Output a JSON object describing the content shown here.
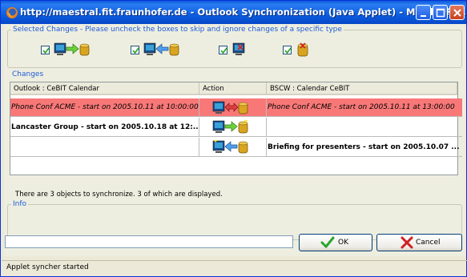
{
  "window": {
    "title": "http://maestral.fit.fraunhofer.de - Outlook Synchronization (Java Applet) - Mozilla Fi..."
  },
  "selected_changes": {
    "legend": "Selected Changes - Please uncheck the boxes to skip and ignore changes of a specific type",
    "options": [
      {
        "checked": true,
        "icon": "new-to-bscw-icon"
      },
      {
        "checked": true,
        "icon": "update-from-bscw-icon"
      },
      {
        "checked": true,
        "icon": "delete-local-icon"
      },
      {
        "checked": true,
        "icon": "delete-remote-icon"
      }
    ]
  },
  "changes": {
    "legend": "Changes",
    "columns": [
      "Outlook : CeBIT Calendar",
      "Action",
      "BSCW : Calendar CeBIT"
    ],
    "rows": [
      {
        "left": "Phone Conf ACME - start on 2005.10.11 at 10:00:00",
        "action": "conflict-icon",
        "right": "Phone Conf ACME - start on 2005.10.11 at 13:00:00",
        "highlight": "#f87878"
      },
      {
        "left": "Lancaster Group - start on 2005.10.18 at 12:...",
        "action": "export-icon",
        "right": ""
      },
      {
        "left": "",
        "action": "import-icon",
        "right": "Briefing for presenters - start on 2005.10.07 ..."
      }
    ]
  },
  "info": {
    "legend": "Info",
    "text": "There are 3 objects to synchronize. 3 of which are displayed."
  },
  "buttons": {
    "ok": "OK",
    "cancel": "Cancel"
  },
  "status": "Applet syncher started"
}
